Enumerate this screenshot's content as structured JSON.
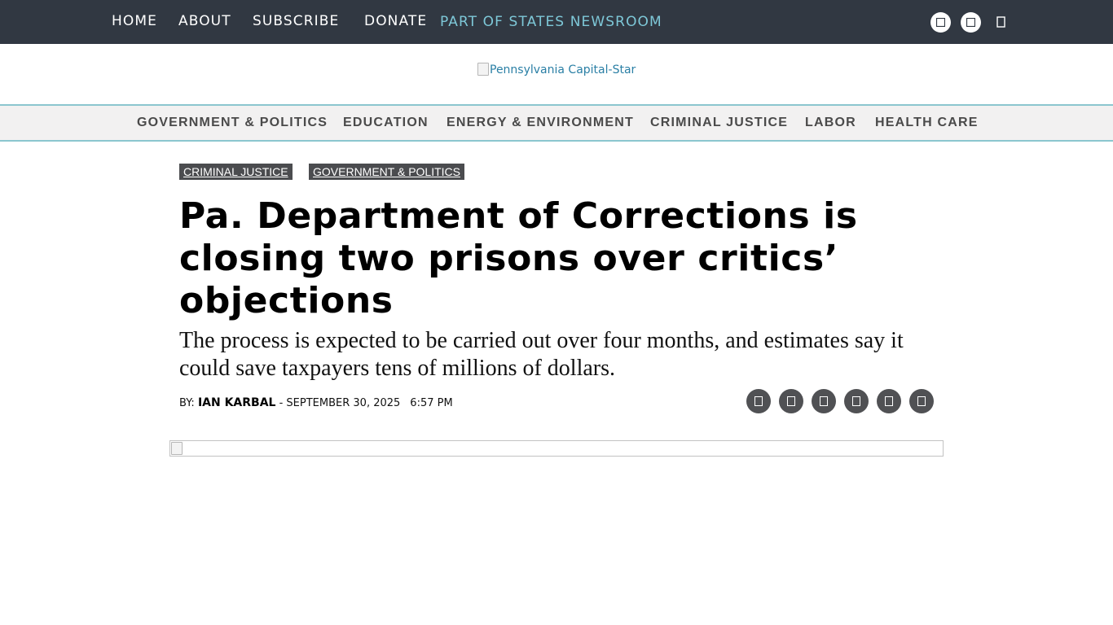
{
  "top_nav": {
    "items": [
      {
        "label": "HOME"
      },
      {
        "label": "ABOUT"
      },
      {
        "label": "SUBSCRIBE"
      },
      {
        "label": "DONATE"
      }
    ],
    "states_link": "PART OF STATES NEWSROOM",
    "social_icons": [
      "facebook-icon",
      "twitter-icon",
      "search-icon"
    ]
  },
  "logo": {
    "alt_text": "Pennsylvania Capital-Star"
  },
  "category_nav": {
    "items": [
      {
        "label": "GOVERNMENT & POLITICS"
      },
      {
        "label": "EDUCATION"
      },
      {
        "label": "ENERGY & ENVIRONMENT"
      },
      {
        "label": "CRIMINAL JUSTICE"
      },
      {
        "label": "LABOR"
      },
      {
        "label": "HEALTH CARE"
      }
    ]
  },
  "article": {
    "tags": [
      {
        "label": "CRIMINAL JUSTICE"
      },
      {
        "label": "GOVERNMENT & POLITICS"
      }
    ],
    "headline": "Pa. Department of Corrections is closing two prisons over critics’ objections",
    "subheadline": "The process is expected to be carried out over four months, and estimates say it could save taxpayers tens of millions of dollars.",
    "byline": {
      "prefix": "BY: ",
      "author": "IAN KARBAL",
      "date": " - SEPTEMBER 30, 2025",
      "time": "6:57 PM"
    },
    "share_icons": [
      "facebook-share-icon",
      "twitter-share-icon",
      "linkedin-share-icon",
      "email-share-icon",
      "print-share-icon",
      "republish-icon"
    ]
  },
  "colors": {
    "topbar_bg": "#313842",
    "accent_teal": "#8bc6cf",
    "states_link": "#7ec8d8",
    "tag_bg": "#4b4c4f",
    "share_bg": "#505154"
  }
}
